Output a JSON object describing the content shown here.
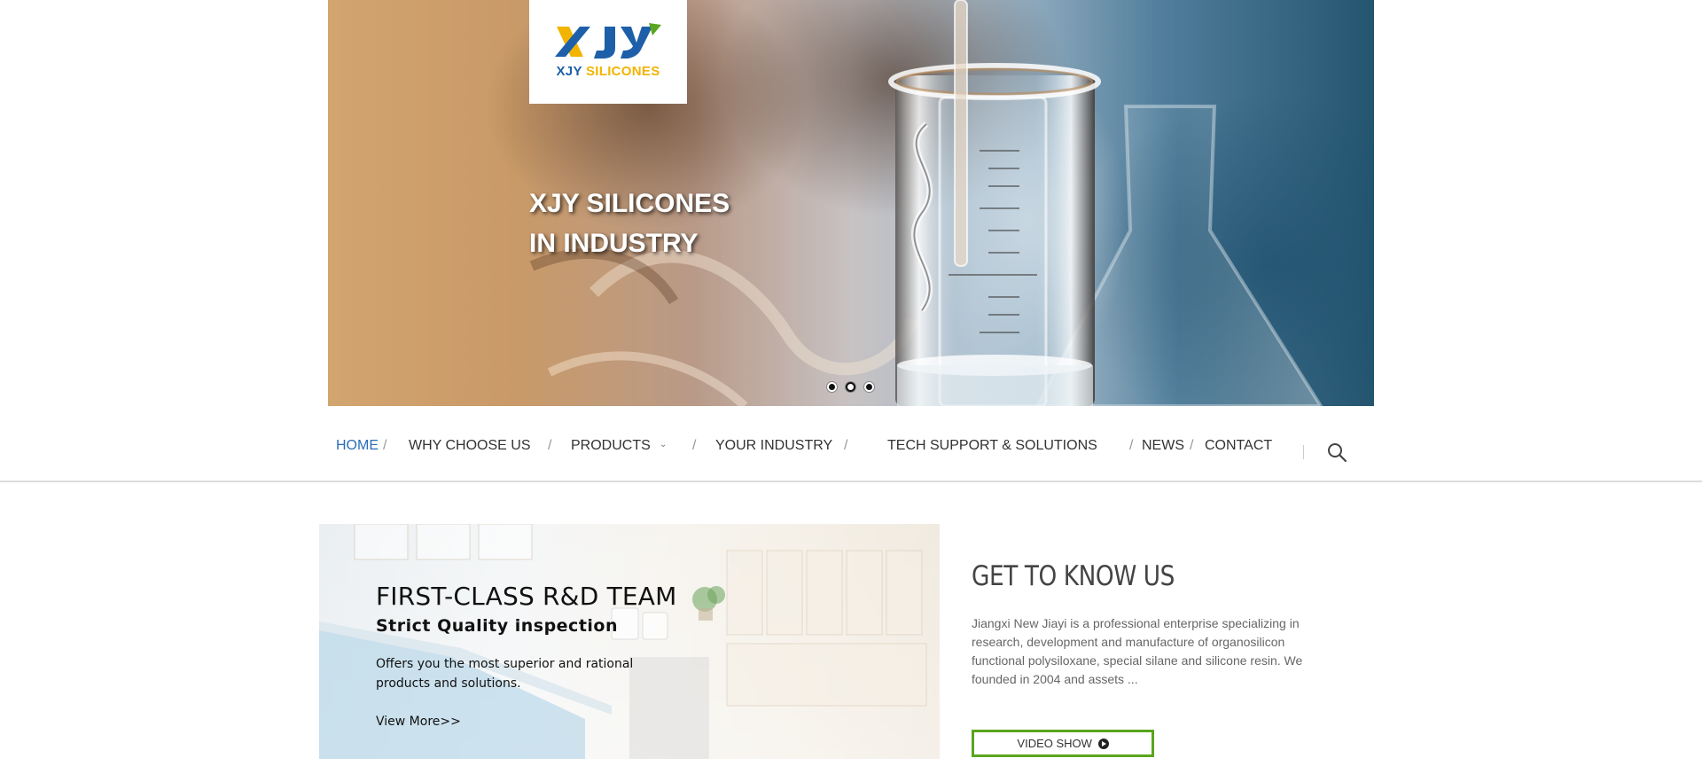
{
  "brand": {
    "logo_text_part1": "XJY",
    "logo_text_part2": "SILICONES",
    "colors": {
      "blue": "#1d5fa8",
      "yellow": "#f2b400",
      "green": "#5aa51e"
    }
  },
  "hero": {
    "line1": "XJY SILICONES",
    "line2": "IN INDUSTRY",
    "slide_count": 3,
    "active_slide": 1
  },
  "nav": {
    "items": [
      {
        "label": "HOME",
        "active": true
      },
      {
        "label": "WHY CHOOSE US"
      },
      {
        "label": "PRODUCTS",
        "has_dropdown": true
      },
      {
        "label": "YOUR INDUSTRY"
      },
      {
        "label": "TECH SUPPORT & SOLUTIONS"
      },
      {
        "label": "NEWS"
      },
      {
        "label": "CONTACT"
      }
    ],
    "separator": "/",
    "search_icon": "search-icon",
    "active_color": "#2a6eb5"
  },
  "promo": {
    "title": "FIRST-CLASS R&D TEAM",
    "subtitle": "Strict Quality inspection",
    "description": "Offers you the most superior and rational products and solutions.",
    "link_label": "View More>>"
  },
  "about": {
    "title": "GET TO KNOW US",
    "text": "Jiangxi New Jiayi is  a professional enterprise specializing in research, development and manufacture of organosilicon functional polysiloxane, special silane and silicone resin. We founded in 2004 and assets ...",
    "video_button_label": "VIDEO SHOW",
    "video_icon": "play-circle-icon"
  }
}
